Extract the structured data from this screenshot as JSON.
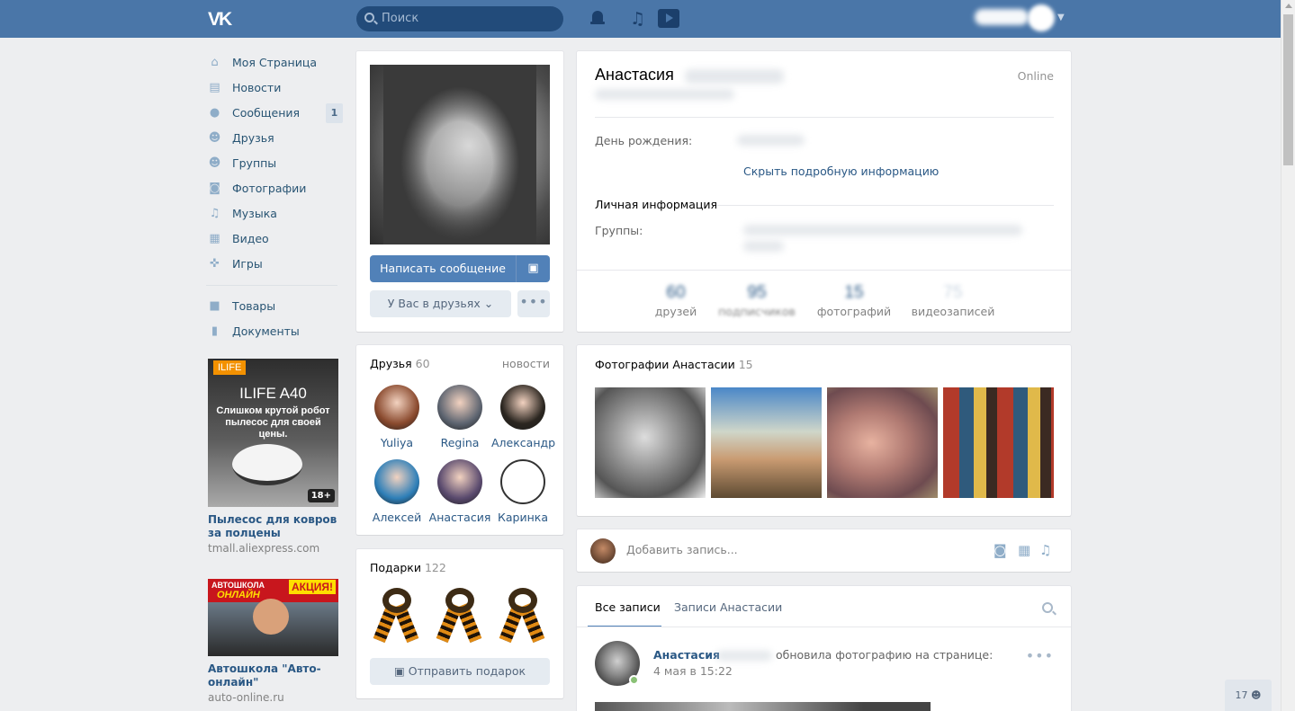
{
  "header": {
    "logo": "VK",
    "search_placeholder": "Поиск"
  },
  "sidebar": {
    "items": [
      {
        "label": "Моя Страница",
        "icon": "home-icon"
      },
      {
        "label": "Новости",
        "icon": "news-icon"
      },
      {
        "label": "Сообщения",
        "icon": "messages-icon",
        "badge": "1"
      },
      {
        "label": "Друзья",
        "icon": "friends-icon"
      },
      {
        "label": "Группы",
        "icon": "groups-icon"
      },
      {
        "label": "Фотографии",
        "icon": "camera-icon"
      },
      {
        "label": "Музыка",
        "icon": "music-icon"
      },
      {
        "label": "Видео",
        "icon": "video-icon"
      },
      {
        "label": "Игры",
        "icon": "gamepad-icon"
      }
    ],
    "extra_items": [
      {
        "label": "Товары",
        "icon": "bag-icon"
      },
      {
        "label": "Документы",
        "icon": "document-icon"
      }
    ],
    "ads": [
      {
        "tag": "ILIFE",
        "image_title": "ILIFE A40",
        "image_subtitle": "Слишком крутой робот пылесос для своей цены.",
        "age": "18+",
        "title": "Пылесос для ковров за полцены",
        "domain": "tmall.aliexpress.com"
      },
      {
        "image_line1": "АВТОШКОЛА",
        "image_line2": "ОНЛАЙН",
        "image_badge": "АКЦИЯ!",
        "title": "Автошкола \"Авто-онлайн\"",
        "domain": "auto-online.ru"
      }
    ]
  },
  "profile": {
    "send_message": "Написать сообщение",
    "friend_status": "У Вас в друзьях",
    "more": "•••"
  },
  "friends_block": {
    "title": "Друзья",
    "count": "60",
    "news_link": "новости",
    "friends": [
      {
        "name": "Yuliya",
        "color": "#8a4a2e"
      },
      {
        "name": "Regina",
        "color": "#5d6470"
      },
      {
        "name": "Александр",
        "color": "#2b2620"
      },
      {
        "name": "Алексей",
        "color": "#2e7fb8"
      },
      {
        "name": "Анастасия",
        "color": "#5a4a6e"
      },
      {
        "name": "Каринка",
        "color": "#ffffff"
      }
    ]
  },
  "gifts_block": {
    "title": "Подарки",
    "count": "122",
    "send_gift": "Отправить подарок"
  },
  "info": {
    "name": "Анастасия",
    "status": "Online",
    "birthday_label": "День рождения:",
    "toggle_details": "Скрыть подробную информацию",
    "personal_section": "Личная информация",
    "groups_label": "Группы:",
    "counters": [
      {
        "num": "60",
        "label": "друзей"
      },
      {
        "num": "95",
        "label": "подписчиков"
      },
      {
        "num": "15",
        "label": "фотографий"
      },
      {
        "num": "75",
        "label": "видеозаписей"
      }
    ]
  },
  "photos_block": {
    "title": "Фотографии Анастасии",
    "count": "15"
  },
  "post_box": {
    "placeholder": "Добавить запись..."
  },
  "wall": {
    "tabs": [
      "Все записи",
      "Записи Анастасии"
    ],
    "post": {
      "author": "Анастасия",
      "action": "обновила фотографию на странице:",
      "date": "4 мая в 15:22",
      "more": "•••"
    }
  },
  "chat_counter": "17"
}
